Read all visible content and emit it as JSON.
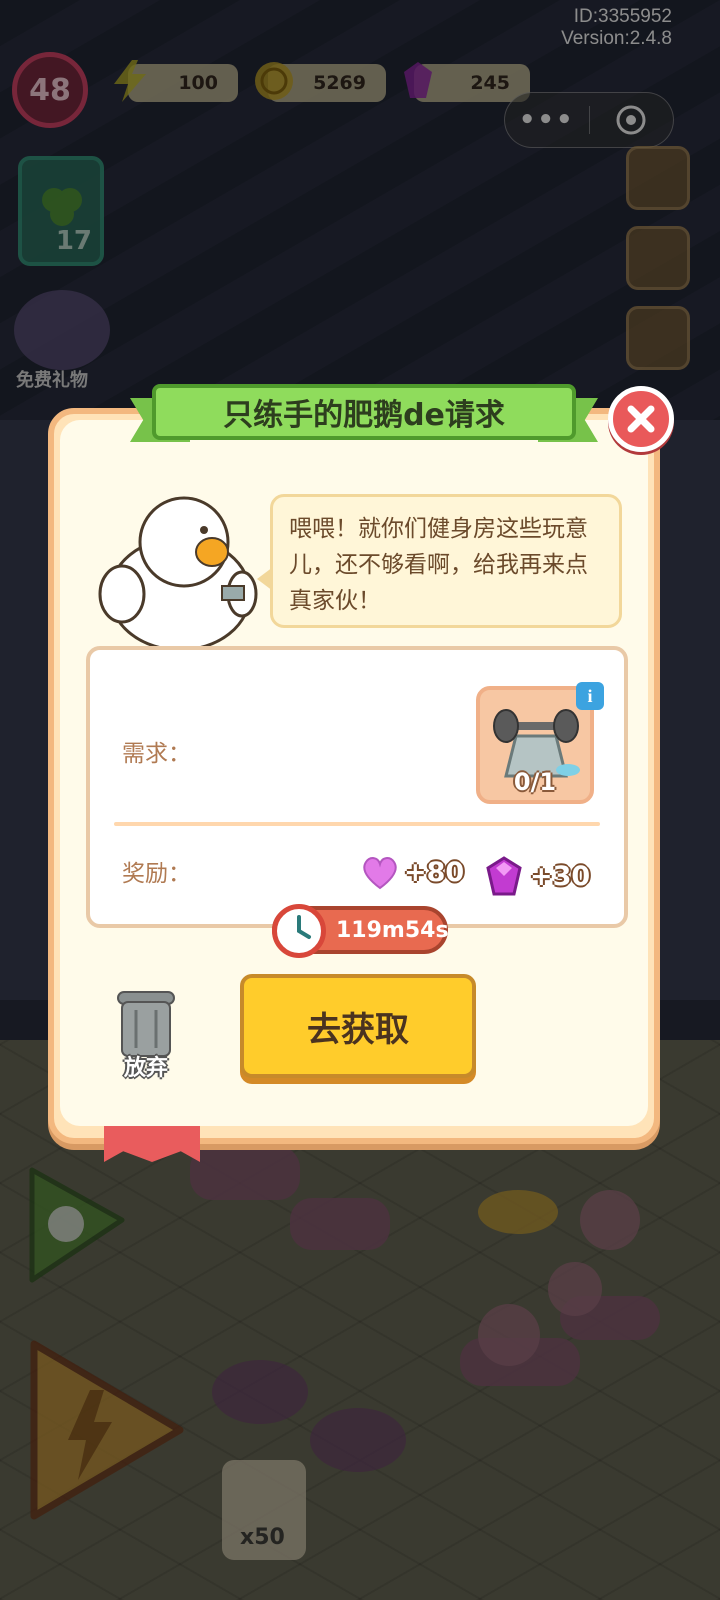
{
  "hud": {
    "id_text": "ID:3355952",
    "version_text": "Version:2.4.8",
    "level": "48",
    "energy": "100",
    "coins": "5269",
    "gems": "245"
  },
  "sidebar": {
    "card_count": "17",
    "free_gift_label": "免费礼物"
  },
  "bottom": {
    "multiplier": "x50"
  },
  "dialog": {
    "title": "只练手的肥鹅de请求",
    "speech": "喂喂！就你们健身房这些玩意儿，还不够看啊，给我再来点真家伙！",
    "requirement_label": "需求：",
    "requirement_item": "dumbbell-rack-icon",
    "requirement_count": "0/1",
    "reward_label": "奖励：",
    "rewards": [
      {
        "icon": "heart-icon",
        "value": "+80",
        "color": "#e27ae8"
      },
      {
        "icon": "gem-icon",
        "value": "+30",
        "color": "#c23bd1"
      }
    ],
    "timer": "119m54s",
    "abandon_label": "放弃",
    "get_button": "去获取"
  },
  "colors": {
    "ribbon": "#8fdc5c",
    "button": "#ffcc2b",
    "close": "#e9595a",
    "dialog_bg": "#fffbea"
  }
}
